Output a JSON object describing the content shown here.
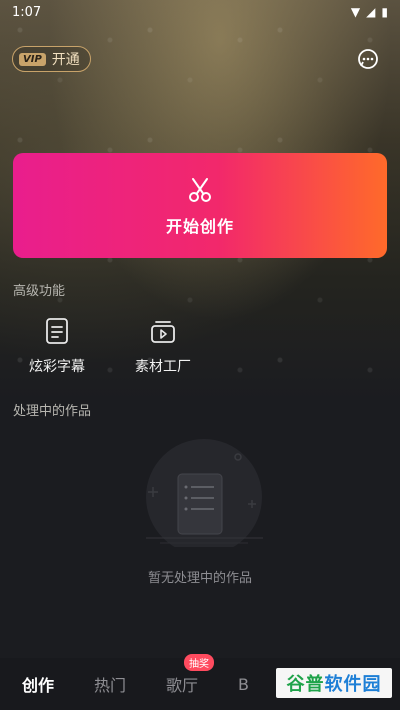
{
  "status": {
    "time": "1:07"
  },
  "header": {
    "vip_badge": "VIP",
    "vip_label": "开通"
  },
  "create": {
    "label": "开始创作"
  },
  "advanced": {
    "title": "高级功能",
    "items": [
      {
        "label": "炫彩字幕",
        "icon": "subtitle-icon"
      },
      {
        "label": "素材工厂",
        "icon": "material-icon"
      }
    ]
  },
  "processing": {
    "title": "处理中的作品",
    "empty_text": "暂无处理中的作品"
  },
  "tabs": [
    {
      "label": "创作",
      "active": true
    },
    {
      "label": "热门",
      "active": false
    },
    {
      "label": "歌厅",
      "active": false,
      "badge": "抽奖"
    },
    {
      "label": "B",
      "active": false
    }
  ],
  "watermark": {
    "part1": "谷普",
    "part2": "软件园"
  },
  "colors": {
    "accent_start": "#e91e8d",
    "accent_end": "#ff6a2a",
    "vip_gold": "#c8a36a"
  }
}
